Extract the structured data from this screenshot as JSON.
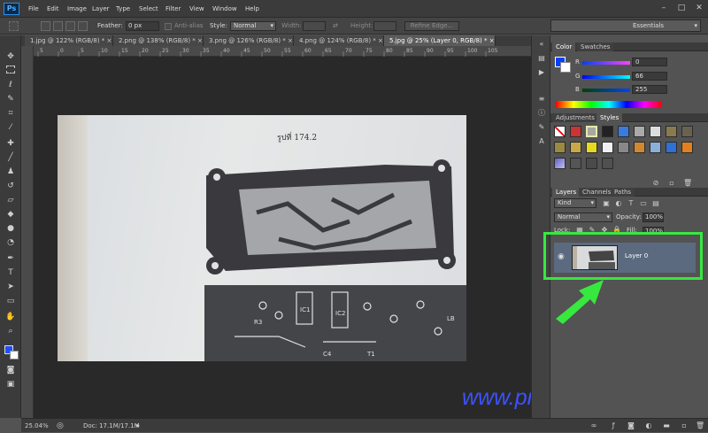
{
  "app": {
    "logo": "Ps"
  },
  "menu": [
    "File",
    "Edit",
    "Image",
    "Layer",
    "Type",
    "Select",
    "Filter",
    "View",
    "Window",
    "Help"
  ],
  "window_controls": {
    "minimize": "–",
    "maximize": "□",
    "close": "✕"
  },
  "options": {
    "feather_label": "Feather:",
    "feather_value": "0 px",
    "antialias_label": "Anti-alias",
    "style_label": "Style:",
    "style_value": "Normal",
    "width_label": "Width:",
    "height_label": "Height:",
    "refine_edge": "Refine Edge..."
  },
  "workspace": "Essentials",
  "doc_tabs": [
    {
      "label": "1.jpg @ 122% (RGB/8) *",
      "close": "×"
    },
    {
      "label": "2.png @ 138% (RGB/8) *",
      "close": "×"
    },
    {
      "label": "3.png @ 126% (RGB/8) *",
      "close": "×"
    },
    {
      "label": "4.png @ 124% (RGB/8) *",
      "close": "×"
    },
    {
      "label": "5.jpg @ 25% (Layer 0, RGB/8) *",
      "close": "×"
    }
  ],
  "ruler_ticks": [
    "5",
    "0",
    "5",
    "10",
    "15",
    "20",
    "25",
    "30",
    "35",
    "40",
    "45",
    "50",
    "55",
    "60",
    "65",
    "70",
    "75",
    "80",
    "85",
    "90",
    "95",
    "100",
    "105"
  ],
  "canvas": {
    "caption": "รูปที่ 174.2",
    "ic1": "IC1",
    "ic2": "IC2",
    "c4": "C4",
    "lb": "LB",
    "r3": "R3",
    "t1": "T1"
  },
  "status": {
    "zoom": "25.04%",
    "doc": "Doc: 17.1M/17.1M"
  },
  "watermark": "www.praphas.com",
  "color_panel": {
    "tabs": [
      "Color",
      "Swatches"
    ],
    "channels": [
      {
        "label": "R",
        "value": "0"
      },
      {
        "label": "G",
        "value": "66"
      },
      {
        "label": "B",
        "value": "255"
      }
    ]
  },
  "styles_panel": {
    "tabs": [
      "Adjustments",
      "Styles"
    ]
  },
  "layers_panel": {
    "tabs": [
      "Layers",
      "Channels",
      "Paths"
    ],
    "kind": "Kind",
    "blend_mode": "Normal",
    "opacity_label": "Opacity:",
    "opacity_value": "100%",
    "lock_label": "Lock:",
    "fill_label": "Fill:",
    "fill_value": "100%",
    "layers": [
      {
        "name": "Layer 0",
        "visible_icon": "◉"
      }
    ]
  },
  "colors": {
    "foreground": "#0042ff",
    "highlight_green": "#37e83f",
    "watermark": "#3d52ff"
  }
}
